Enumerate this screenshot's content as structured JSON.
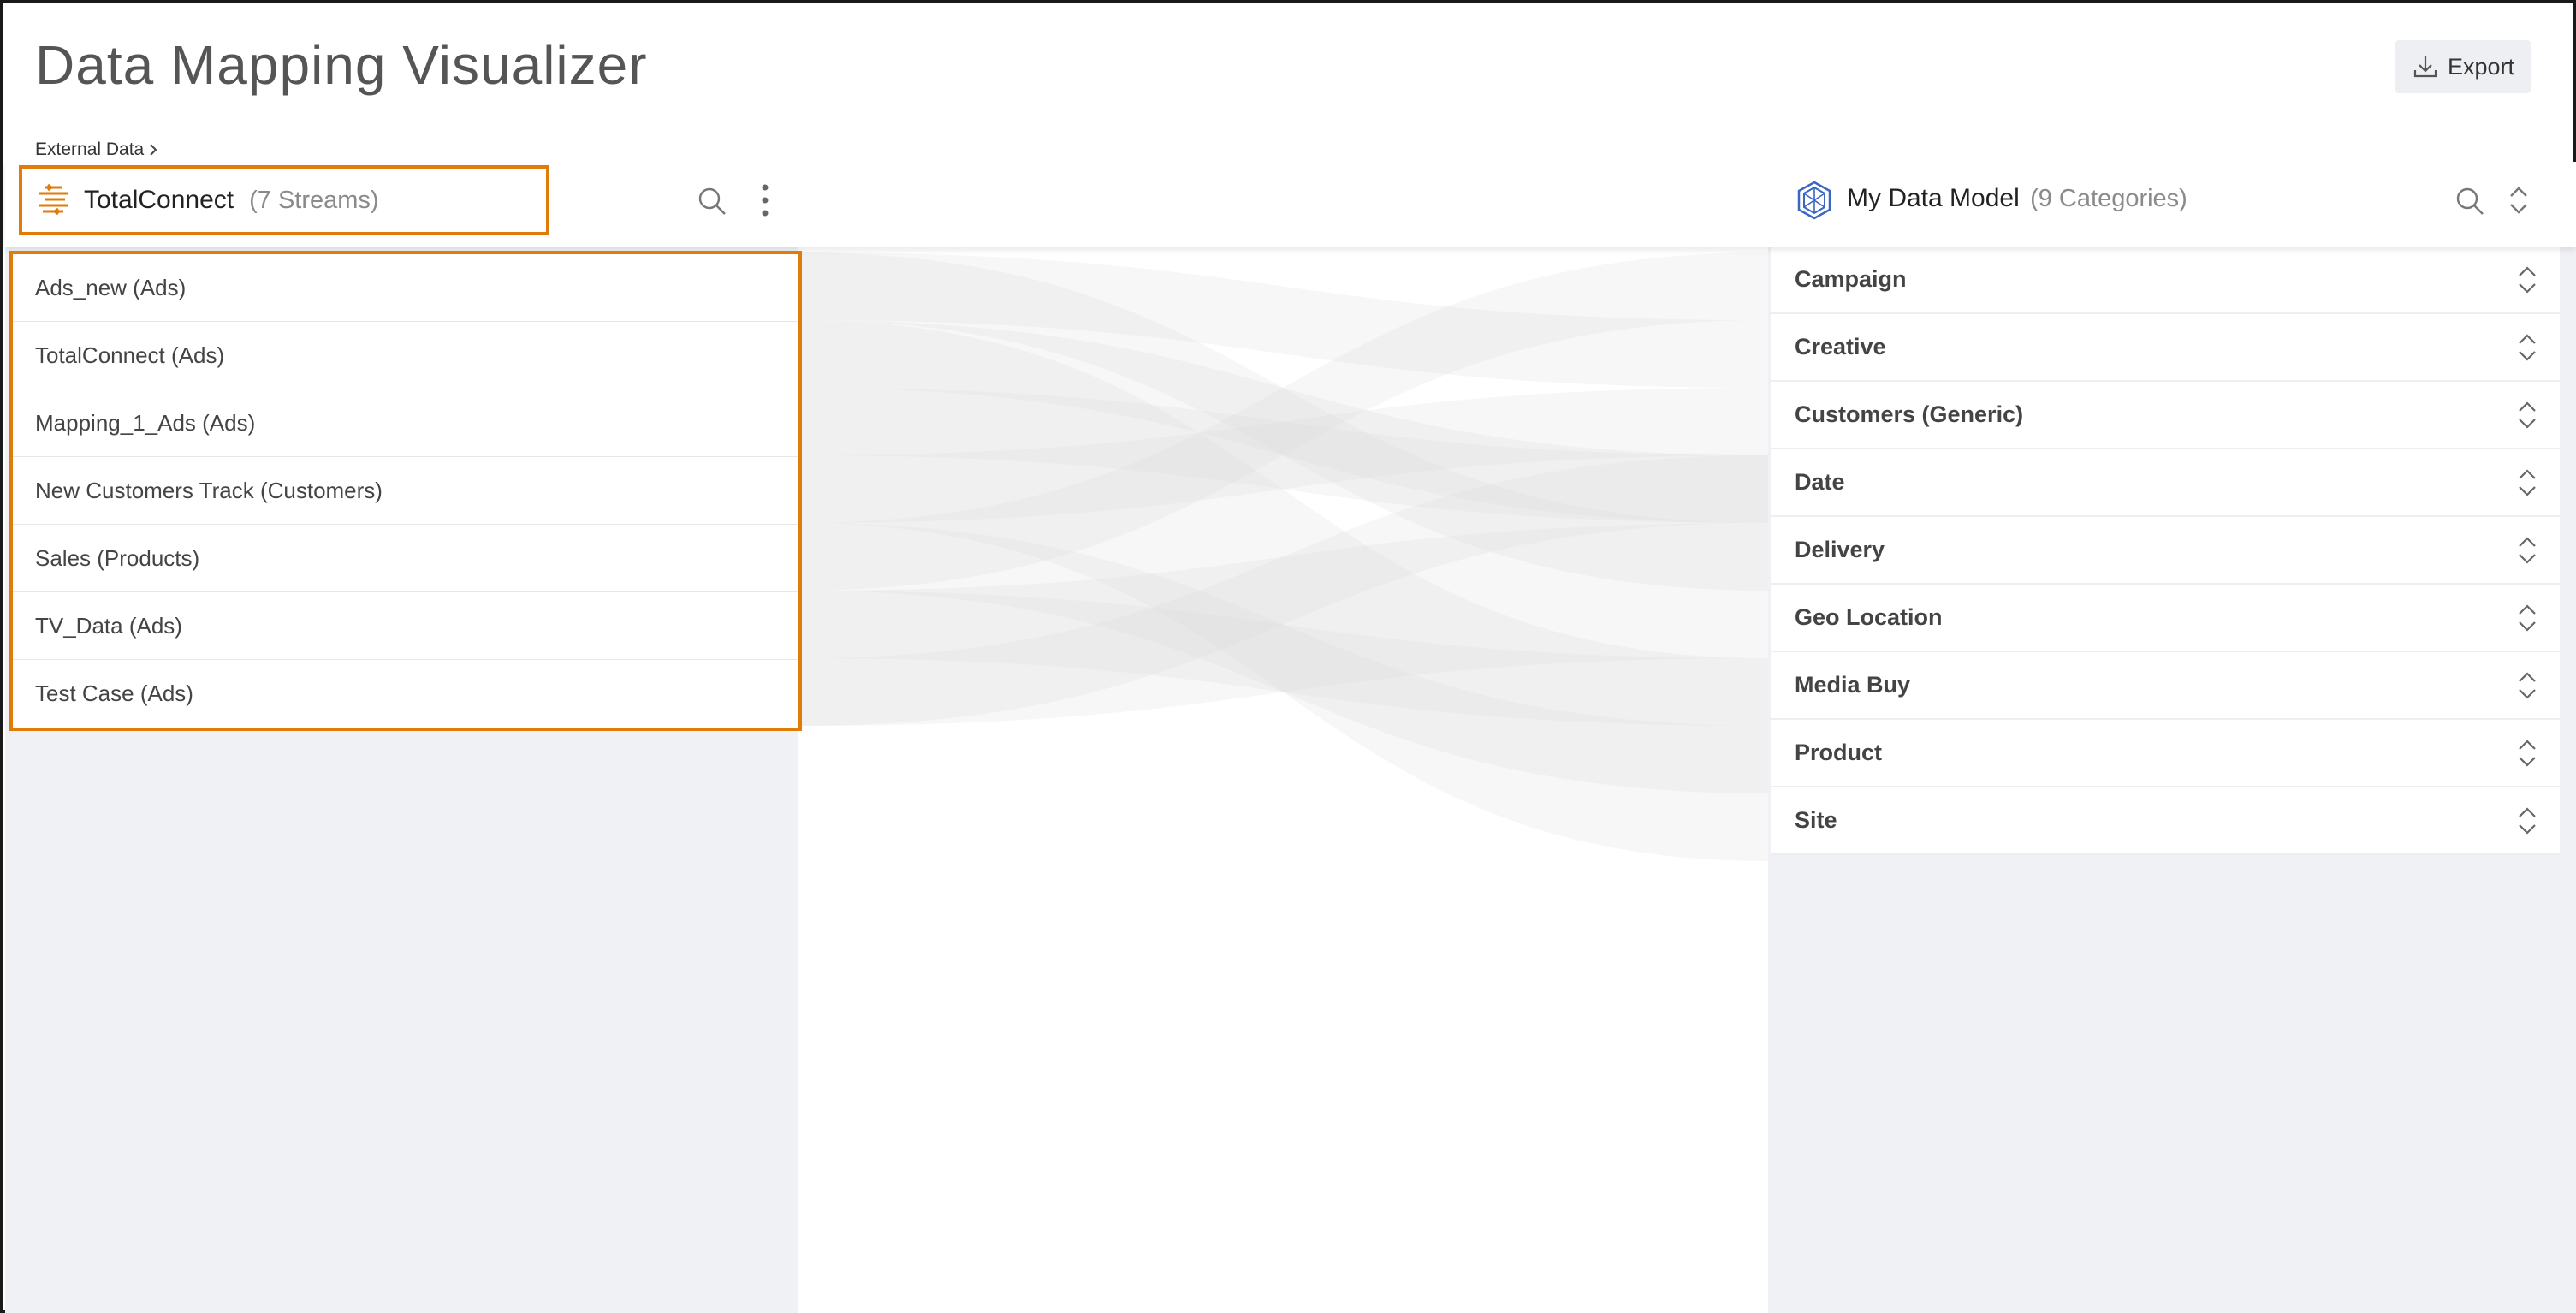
{
  "app": {
    "title": "Data Mapping Visualizer",
    "export_label": "Export"
  },
  "breadcrumb": {
    "label": "External Data"
  },
  "source": {
    "name": "TotalConnect",
    "count_label": "(7 Streams)",
    "icon": "stream-source-icon",
    "streams": [
      "Ads_new (Ads)",
      "TotalConnect (Ads)",
      "Mapping_1_Ads (Ads)",
      "New Customers Track (Customers)",
      "Sales (Products)",
      "TV_Data (Ads)",
      "Test Case (Ads)"
    ]
  },
  "destination": {
    "name": "My Data Model",
    "count_label": "(9 Categories)",
    "icon": "data-model-icon",
    "categories": [
      "Campaign",
      "Creative",
      "Customers (Generic)",
      "Date",
      "Delivery",
      "Geo Location",
      "Media Buy",
      "Product",
      "Site"
    ]
  },
  "colors": {
    "accent": "#e07c0a",
    "model_icon": "#3a66c4",
    "flow": "#d9d9d9",
    "panel_bg": "#f0f1f4"
  }
}
